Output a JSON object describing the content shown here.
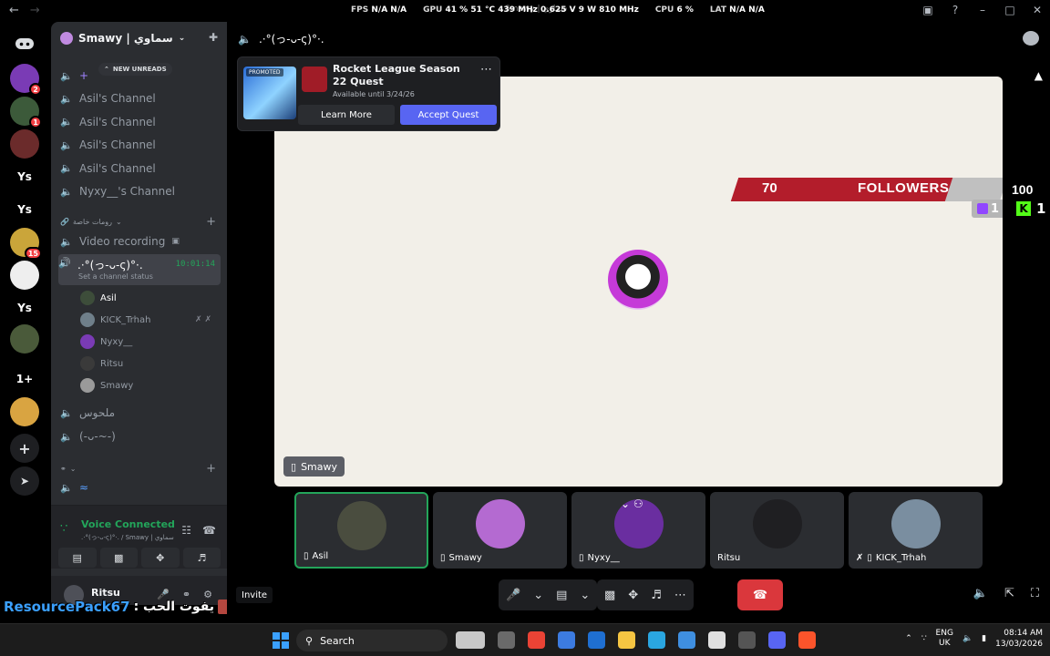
{
  "titlebar": {
    "overlay": {
      "fps_label": "FPS",
      "fps_value": "N/A  N/A",
      "gpu_label": "GPU",
      "gpu_value": "41 %  51 °C  439 MHz  0.625 V  9 W  810 MHz",
      "cpu_label": "CPU",
      "cpu_value": "6 %",
      "lat_label": "LAT",
      "lat_value": "N/A  N/A"
    },
    "window_title": "Smawy | سماوي"
  },
  "rail": {
    "servers": [
      {
        "label": "",
        "badge": "2",
        "color": "#7a3bb5"
      },
      {
        "label": "",
        "badge": "1",
        "color": "#3c5a3a"
      },
      {
        "label": "",
        "badge": "",
        "color": "#6b2b2b"
      },
      {
        "label": "Ys",
        "badge": "",
        "color": "#000000"
      },
      {
        "label": "Ys",
        "badge": "",
        "color": "#000000"
      },
      {
        "label": "",
        "badge": "15",
        "color": "#caa53a"
      },
      {
        "label": "",
        "badge": "",
        "color": "#eeeeee"
      },
      {
        "label": "Ys",
        "badge": "",
        "color": "#000000"
      },
      {
        "label": "",
        "badge": "",
        "color": "#4a5a3a"
      },
      {
        "label": "1+",
        "badge": "",
        "color": "#000000"
      },
      {
        "label": "",
        "badge": "",
        "color": "#d9a441"
      }
    ]
  },
  "sidebar": {
    "server_name": "Smawy | سماوي",
    "new_unreads": "NEW UNREADS",
    "channels": [
      {
        "name": "Asil's Channel"
      },
      {
        "name": "Asil's Channel"
      },
      {
        "name": "Asil's Channel"
      },
      {
        "name": "Asil's Channel"
      },
      {
        "name": "Nyxy__'s Channel"
      }
    ],
    "category_private": "رومات خاصة",
    "video_recording": "Video recording",
    "active_channel": {
      "name": ".·°(っ-ᴗ-ς)°·.",
      "time": "10:01:14",
      "status": "Set a channel status"
    },
    "members": [
      {
        "name": "Asil",
        "color": "#3d4d3a"
      },
      {
        "name": "KICK_Trhah",
        "color": "#6f7f8a"
      },
      {
        "name": "Nyxy__",
        "color": "#7a3bb5"
      },
      {
        "name": "Ritsu",
        "color": "#3a3a3a"
      },
      {
        "name": "Smawy",
        "color": "#9a9a9a"
      }
    ],
    "extra_channels": [
      {
        "name": "ملحوس"
      },
      {
        "name": "(-ᴗ-~-)"
      }
    ],
    "voice": {
      "title": "Voice Connected",
      "subtitle": ".·°(っ-ᴗ-ς)°·. / Smawy | سماوي"
    },
    "user": {
      "name": "Ritsu"
    }
  },
  "overlay_text": {
    "resourcepack": "ResourcePack67",
    "arabic": ": يفوت الحب"
  },
  "stage": {
    "channel_title": ".·°(っ-ᴗ-ς)°·.",
    "quest": {
      "promoted": "PROMOTED",
      "title": "Rocket League Season 22 Quest",
      "subtitle": "Available until 3/24/26",
      "learn_more": "Learn More",
      "accept": "Accept Quest"
    },
    "stream": {
      "followers_count": "70",
      "followers_label": "FOLLOWERS",
      "twitch_count": "1",
      "side_top": "100",
      "kick_count": "1",
      "tag": "Smawy"
    },
    "participants": [
      {
        "name": "Asil",
        "color": "#4a4d3f",
        "speaking": true
      },
      {
        "name": "Smawy",
        "color": "#b46ad1",
        "speaking": false
      },
      {
        "name": "Nyxy__",
        "color": "#6a2ea0",
        "speaking": false
      },
      {
        "name": "Ritsu",
        "color": "#1f1f22",
        "speaking": false
      },
      {
        "name": "KICK_Trhah",
        "color": "#7a8ea0",
        "speaking": false
      }
    ],
    "invite": "Invite"
  },
  "taskbar": {
    "search": "Search",
    "lang": "ENG",
    "region": "UK",
    "time": "08:14 AM",
    "date": "13/03/2026",
    "apps": [
      "#c8c8c8",
      "#6a6a6a",
      "#ea4335",
      "#3c7be0",
      "#1f6fd1",
      "#f5c542",
      "#2aa6e0",
      "#3f8fe0",
      "#e0e0e0",
      "#555555",
      "#5865f2",
      "#fb542b"
    ]
  }
}
